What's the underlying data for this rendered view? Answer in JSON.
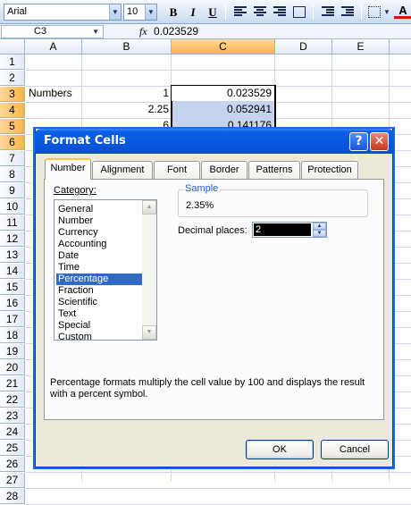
{
  "toolbar": {
    "font_name": "Arial",
    "font_size": "10",
    "bold_label": "B",
    "italic_label": "I",
    "underline_label": "U",
    "font_color_label": "A"
  },
  "formula_bar": {
    "name_box": "C3",
    "fx_label": "fx",
    "value": "0.023529"
  },
  "sheet": {
    "columns": [
      "A",
      "B",
      "C",
      "D",
      "E"
    ],
    "rows": [
      "1",
      "2",
      "3",
      "4",
      "5",
      "6",
      "7",
      "8",
      "9",
      "10",
      "11",
      "12",
      "13",
      "14",
      "15",
      "16",
      "17",
      "18",
      "19",
      "20",
      "21",
      "22",
      "23",
      "24",
      "25",
      "26",
      "27",
      "28"
    ],
    "cells": {
      "A3": "Numbers",
      "B3": "1",
      "B4": "2.25",
      "B5": "6",
      "C3": "0.023529",
      "C4": "0.052941",
      "C5": "0.141176"
    },
    "selected_column": "C",
    "selected_rows": [
      "3",
      "4",
      "5",
      "6"
    ]
  },
  "dialog": {
    "title": "Format Cells",
    "help_label": "?",
    "close_label": "✕",
    "tabs": [
      "Number",
      "Alignment",
      "Font",
      "Border",
      "Patterns",
      "Protection"
    ],
    "active_tab": "Number",
    "category_label": "Category:",
    "categories": [
      "General",
      "Number",
      "Currency",
      "Accounting",
      "Date",
      "Time",
      "Percentage",
      "Fraction",
      "Scientific",
      "Text",
      "Special",
      "Custom"
    ],
    "selected_category": "Percentage",
    "sample_label": "Sample",
    "sample_value": "2.35%",
    "decimal_places_label": "Decimal places:",
    "decimal_places_value": "2",
    "description": "Percentage formats multiply the cell value by 100 and displays the result with a percent symbol.",
    "ok_label": "OK",
    "cancel_label": "Cancel"
  }
}
